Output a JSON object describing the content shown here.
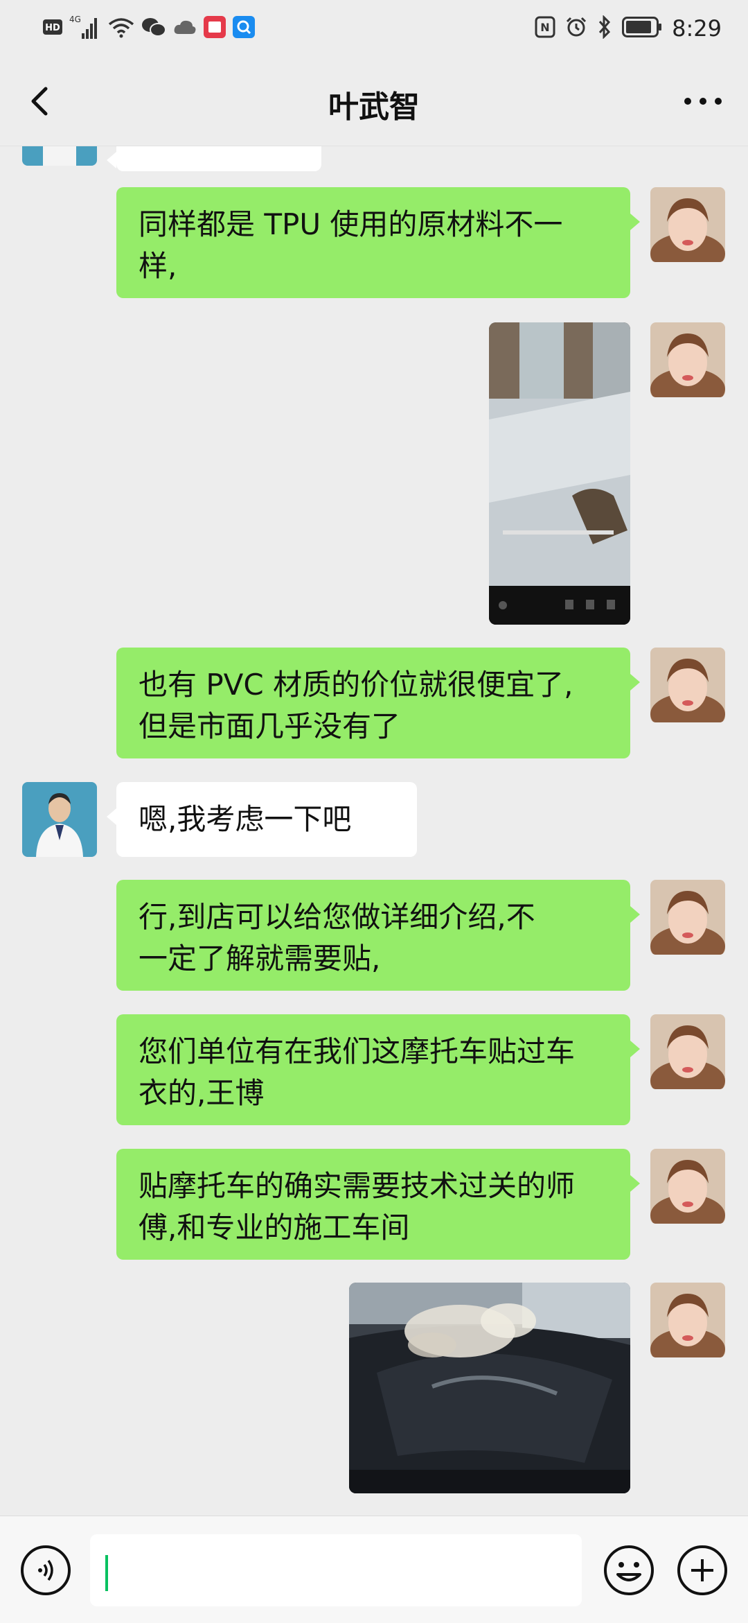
{
  "status_bar": {
    "network_label": "HD",
    "signal_type": "4G",
    "time": "8:29",
    "icons": [
      "hd-icon",
      "signal-icon",
      "wifi-icon",
      "wechat-icon",
      "cloud-icon",
      "red-app-icon",
      "blue-app-icon",
      "nfc-icon",
      "alarm-icon",
      "bluetooth-icon",
      "battery-icon"
    ]
  },
  "header": {
    "title": "叶武智",
    "back_icon": "chevron-left-icon",
    "more_icon": "more-dots-icon"
  },
  "messages": [
    {
      "type": "text",
      "sender": "me",
      "lines": [
        "同样都是 TPU 使用的原材料不一",
        "样,"
      ]
    },
    {
      "type": "image",
      "sender": "me",
      "content": "video-screenshot"
    },
    {
      "type": "text",
      "sender": "me",
      "lines": [
        "也有 PVC 材质的价位就很便宜了,",
        "但是市面几乎没有了"
      ]
    },
    {
      "type": "text",
      "sender": "them",
      "lines": [
        "嗯,我考虑一下吧"
      ]
    },
    {
      "type": "text",
      "sender": "me",
      "lines": [
        "行,到店可以给您做详细介绍,不",
        "一定了解就需要贴,"
      ]
    },
    {
      "type": "text",
      "sender": "me",
      "lines": [
        "您们单位有在我们这摩托车贴过车",
        "衣的,王博"
      ]
    },
    {
      "type": "text",
      "sender": "me",
      "lines": [
        "贴摩托车的确实需要技术过关的师",
        "傅,和专业的施工车间"
      ]
    },
    {
      "type": "image",
      "sender": "me",
      "content": "car-hood-photo"
    }
  ],
  "input_bar": {
    "voice_icon": "voice-icon",
    "text_value": "",
    "emoji_icon": "emoji-icon",
    "plus_icon": "plus-icon"
  },
  "colors": {
    "background": "#ededed",
    "my_bubble": "#95ec69",
    "their_bubble": "#ffffff",
    "caret": "#07c160"
  }
}
